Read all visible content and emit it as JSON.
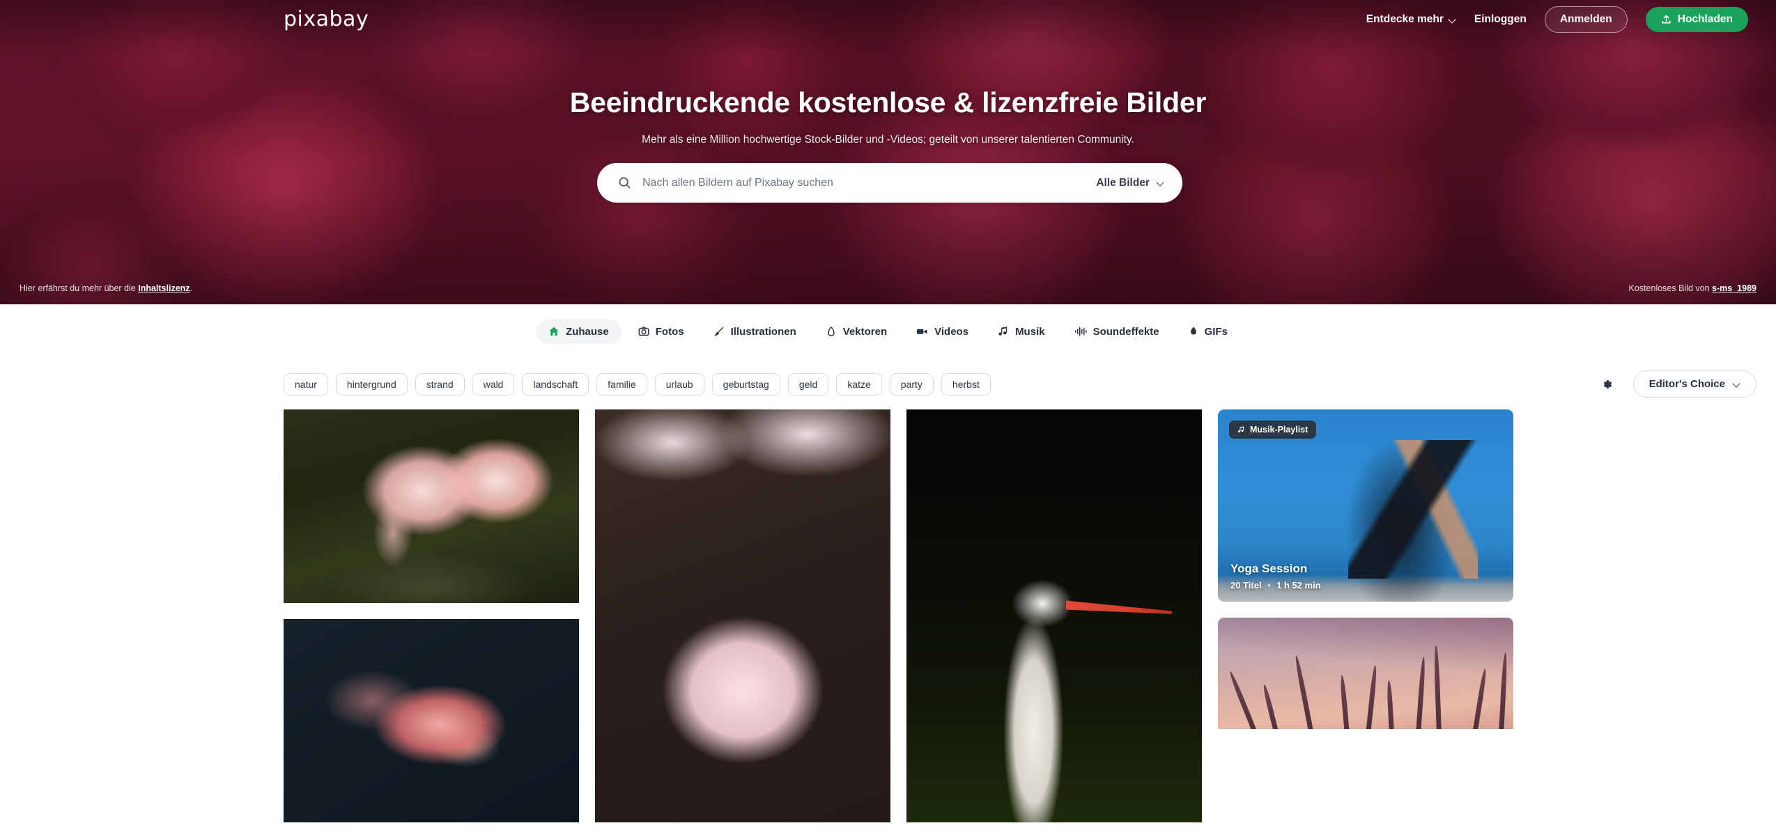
{
  "header": {
    "logo_text": "pixabay",
    "nav": {
      "discover_label": "Entdecke mehr",
      "login_label": "Einloggen",
      "signup_label": "Anmelden",
      "upload_label": "Hochladen"
    }
  },
  "hero": {
    "title": "Beeindruckende kostenlose & lizenzfreie Bilder",
    "subtitle": "Mehr als eine Million hochwertige Stock-Bilder und -Videos; geteilt von unserer talentierten Community.",
    "license_prefix": "Hier erfährst du mehr über die ",
    "license_link": "Inhaltslizenz",
    "license_suffix": ".",
    "credit_prefix": "Kostenloses Bild von ",
    "credit_author": "s-ms_1989",
    "search": {
      "placeholder": "Nach allen Bildern auf Pixabay suchen",
      "value": "",
      "type_label": "Alle Bilder"
    }
  },
  "tabs": [
    {
      "label": "Zuhause",
      "icon": "home-icon",
      "active": true
    },
    {
      "label": "Fotos",
      "icon": "camera-icon",
      "active": false
    },
    {
      "label": "Illustrationen",
      "icon": "brush-icon",
      "active": false
    },
    {
      "label": "Vektoren",
      "icon": "pen-nib-icon",
      "active": false
    },
    {
      "label": "Videos",
      "icon": "video-camera-icon",
      "active": false
    },
    {
      "label": "Musik",
      "icon": "music-note-icon",
      "active": false
    },
    {
      "label": "Soundeffekte",
      "icon": "waveform-icon",
      "active": false
    },
    {
      "label": "GIFs",
      "icon": "droplet-icon",
      "active": false
    }
  ],
  "filters": {
    "tags": [
      "natur",
      "hintergrund",
      "strand",
      "wald",
      "landschaft",
      "familie",
      "urlaub",
      "geburtstag",
      "geld",
      "katze",
      "party",
      "herbst"
    ],
    "settings_icon": "gear-icon",
    "sort_label": "Editor's Choice"
  },
  "gallery": {
    "items": [
      {
        "kind": "photo",
        "subject": "two-flamingos-in-water"
      },
      {
        "kind": "photo",
        "subject": "pink-lotus-flower"
      },
      {
        "kind": "photo",
        "subject": "pink-chrysanthemum-flower"
      },
      {
        "kind": "photo",
        "subject": "white-stork-portrait"
      },
      {
        "kind": "playlist",
        "subject": "yoga-woman-on-beach"
      },
      {
        "kind": "photo",
        "subject": "grass-silhouettes-at-sunset"
      }
    ],
    "playlist": {
      "badge_label": "Musik-Playlist",
      "badge_icon": "music-note-icon",
      "title": "Yoga Session",
      "tracks": "20 Titel",
      "duration": "1 h 52 min"
    }
  },
  "colors": {
    "accent_green": "#1aa35a",
    "hero_overlay": "#5d1526",
    "active_tab_bg": "#f3f4f5",
    "badge_bg": "#2b3847"
  }
}
